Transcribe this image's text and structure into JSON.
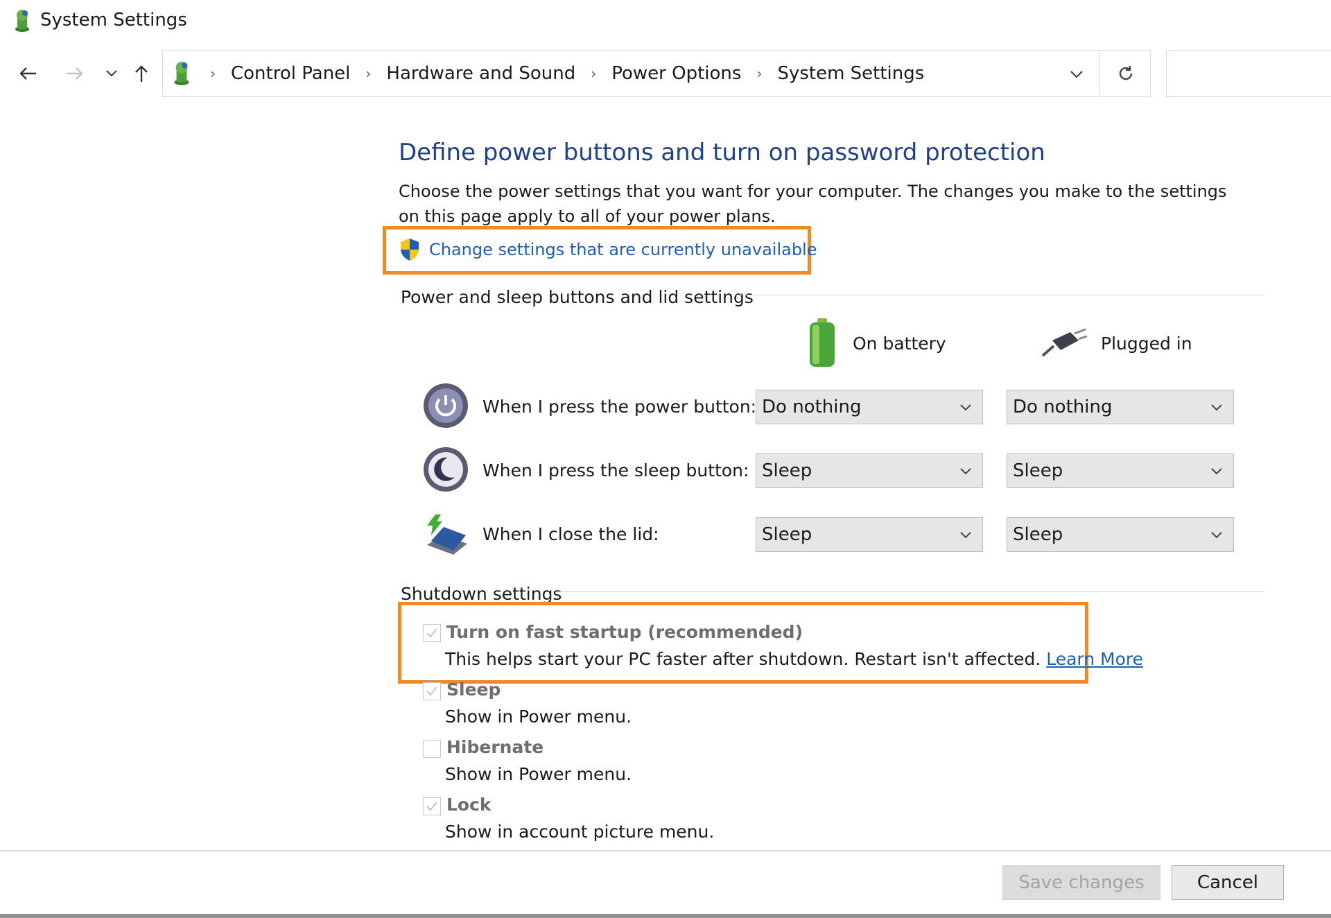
{
  "window": {
    "title": "System Settings",
    "app_icon": "control-panel-icon"
  },
  "nav": {
    "back_icon": "arrow-left-icon",
    "forward_icon": "arrow-right-icon",
    "recent_icon": "chevron-down-icon",
    "up_icon": "arrow-up-icon"
  },
  "address": {
    "crumbs": [
      "Control Panel",
      "Hardware and Sound",
      "Power Options",
      "System Settings"
    ],
    "dropdown_icon": "chevron-down-icon",
    "refresh_icon": "refresh-icon",
    "search_placeholder": ""
  },
  "main": {
    "heading": "Define power buttons and turn on password protection",
    "description": "Choose the power settings that you want for your computer. The changes you make to the settings on this page apply to all of your power plans.",
    "change_link": "Change settings that are currently unavailable",
    "highlight_color": "#f08a24",
    "link_color": "#1f5fb0",
    "heading_color": "#1e3f8a"
  },
  "buttons_section": {
    "title": "Power and sleep buttons and lid settings",
    "col_battery": "On battery",
    "col_plugged": "Plugged in",
    "rows": [
      {
        "label": "When I press the power button:",
        "battery": "Do nothing",
        "plugged": "Do nothing",
        "icon": "power-button-icon"
      },
      {
        "label": "When I press the sleep button:",
        "battery": "Sleep",
        "plugged": "Sleep",
        "icon": "sleep-button-icon"
      },
      {
        "label": "When I close the lid:",
        "battery": "Sleep",
        "plugged": "Sleep",
        "icon": "laptop-lid-icon"
      }
    ]
  },
  "shutdown_section": {
    "title": "Shutdown settings",
    "items": [
      {
        "title": "Turn on fast startup (recommended)",
        "desc": "This helps start your PC faster after shutdown. Restart isn't affected.",
        "link": "Learn More",
        "checked": true
      },
      {
        "title": "Sleep",
        "desc": "Show in Power menu.",
        "checked": true
      },
      {
        "title": "Hibernate",
        "desc": "Show in Power menu.",
        "checked": false
      },
      {
        "title": "Lock",
        "desc": "Show in account picture menu.",
        "checked": true
      }
    ]
  },
  "footer": {
    "save": "Save changes",
    "cancel": "Cancel"
  }
}
